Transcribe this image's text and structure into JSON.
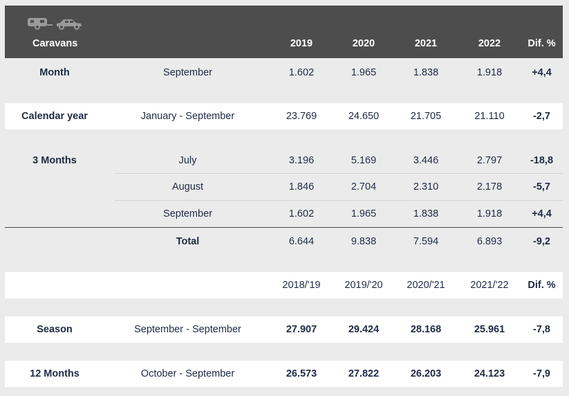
{
  "header": {
    "title": "Caravans",
    "years": [
      "2019",
      "2020",
      "2021",
      "2022"
    ],
    "dif": "Dif. %",
    "icons": [
      "caravan-icon",
      "car-icon"
    ]
  },
  "month": {
    "label": "Month",
    "period": "September",
    "v": [
      "1.602",
      "1.965",
      "1.838",
      "1.918"
    ],
    "dif": "+4,4"
  },
  "calendar": {
    "label": "Calendar year",
    "period": "January - September",
    "v": [
      "23.769",
      "24.650",
      "21.705",
      "21.110"
    ],
    "dif": "-2,7"
  },
  "three_months": {
    "label": "3 Months",
    "rows": [
      {
        "period": "July",
        "v": [
          "3.196",
          "5.169",
          "3.446",
          "2.797"
        ],
        "dif": "-18,8"
      },
      {
        "period": "August",
        "v": [
          "1.846",
          "2.704",
          "2.310",
          "2.178"
        ],
        "dif": "-5,7"
      },
      {
        "period": "September",
        "v": [
          "1.602",
          "1.965",
          "1.838",
          "1.918"
        ],
        "dif": "+4,4"
      }
    ],
    "total": {
      "label": "Total",
      "v": [
        "6.644",
        "9.838",
        "7.594",
        "6.893"
      ],
      "dif": "-9,2"
    }
  },
  "season_header": {
    "years": [
      "2018/'19",
      "2019/'20",
      "2020/'21",
      "2021/'22"
    ],
    "dif": "Dif. %"
  },
  "season": {
    "label": "Season",
    "period": "September - September",
    "v": [
      "27.907",
      "29.424",
      "28.168",
      "25.961"
    ],
    "dif": "-7,8"
  },
  "twelve_months": {
    "label": "12 Months",
    "period": "October - September",
    "v": [
      "26.573",
      "27.822",
      "26.203",
      "24.123"
    ],
    "dif": "-7,9"
  }
}
